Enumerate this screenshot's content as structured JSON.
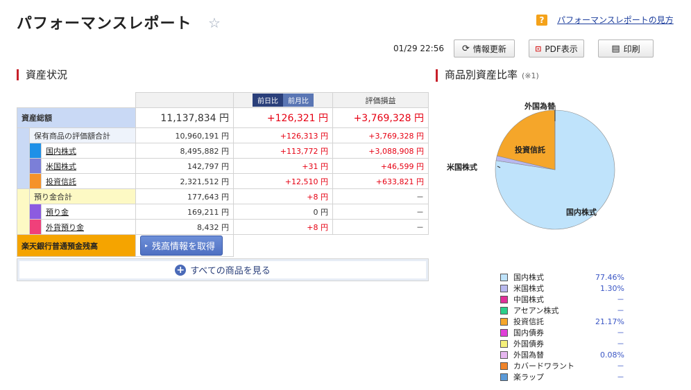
{
  "header": {
    "title": "パフォーマンスレポート",
    "help_link": "パフォーマンスレポートの見方",
    "help_icon": "?"
  },
  "toolbar": {
    "timestamp": "01/29 22:56",
    "refresh_label": "情報更新",
    "pdf_label": "PDF表示",
    "print_label": "印刷"
  },
  "assets": {
    "section_title": "資産状況",
    "tab_day": "前日比",
    "tab_month": "前月比",
    "col_pl": "評価損益",
    "total": {
      "label": "資産総額",
      "value": "11,137,834 円",
      "diff": "+126,321 円",
      "pl": "+3,769,328 円"
    },
    "holdings": {
      "label": "保有商品の評価額合計",
      "value": "10,960,191 円",
      "diff": "+126,313 円",
      "pl": "+3,769,328 円"
    },
    "rows": [
      {
        "label": "国内株式",
        "value": "8,495,882 円",
        "diff": "+113,772 円",
        "pl": "+3,088,908 円",
        "color": "#1e90e8"
      },
      {
        "label": "米国株式",
        "value": "142,797 円",
        "diff": "+31 円",
        "pl": "+46,599 円",
        "color": "#7b7fd8"
      },
      {
        "label": "投資信託",
        "value": "2,321,512 円",
        "diff": "+12,510 円",
        "pl": "+633,821 円",
        "color": "#f5922a"
      }
    ],
    "deposit_total": {
      "label": "預り金合計",
      "value": "177,643 円",
      "diff": "+8 円",
      "pl": "－"
    },
    "deposits": [
      {
        "label": "預り金",
        "value": "169,211 円",
        "diff": "0 円",
        "pl": "－",
        "color": "#8c5be0"
      },
      {
        "label": "外貨預り金",
        "value": "8,432 円",
        "diff": "+8 円",
        "pl": "－",
        "color": "#f0407a"
      }
    ],
    "bank": {
      "label": "楽天銀行普通預金残高",
      "button": "残高情報を取得"
    },
    "all_items": "すべての商品を見る"
  },
  "ratio": {
    "section_title": "商品別資産比率",
    "note": "(※1)",
    "pie_labels": {
      "domestic": "国内株式",
      "us": "米国株式",
      "fund": "投資信託",
      "fx": "外国為替"
    },
    "legend": [
      {
        "name": "国内株式",
        "pct": "77.46%",
        "color": "#bfe3fb"
      },
      {
        "name": "米国株式",
        "pct": "1.30%",
        "color": "#b9b9ef"
      },
      {
        "name": "中国株式",
        "pct": "－",
        "color": "#e0309a"
      },
      {
        "name": "アセアン株式",
        "pct": "－",
        "color": "#2ad08a"
      },
      {
        "name": "投資信託",
        "pct": "21.17%",
        "color": "#f5a62a"
      },
      {
        "name": "国内債券",
        "pct": "－",
        "color": "#e040d8"
      },
      {
        "name": "外国債券",
        "pct": "－",
        "color": "#f5f07a"
      },
      {
        "name": "外国為替",
        "pct": "0.08%",
        "color": "#e6b6f0"
      },
      {
        "name": "カバードワラント",
        "pct": "－",
        "color": "#f0842a"
      },
      {
        "name": "楽ラップ",
        "pct": "－",
        "color": "#5a9ad8"
      }
    ]
  }
}
